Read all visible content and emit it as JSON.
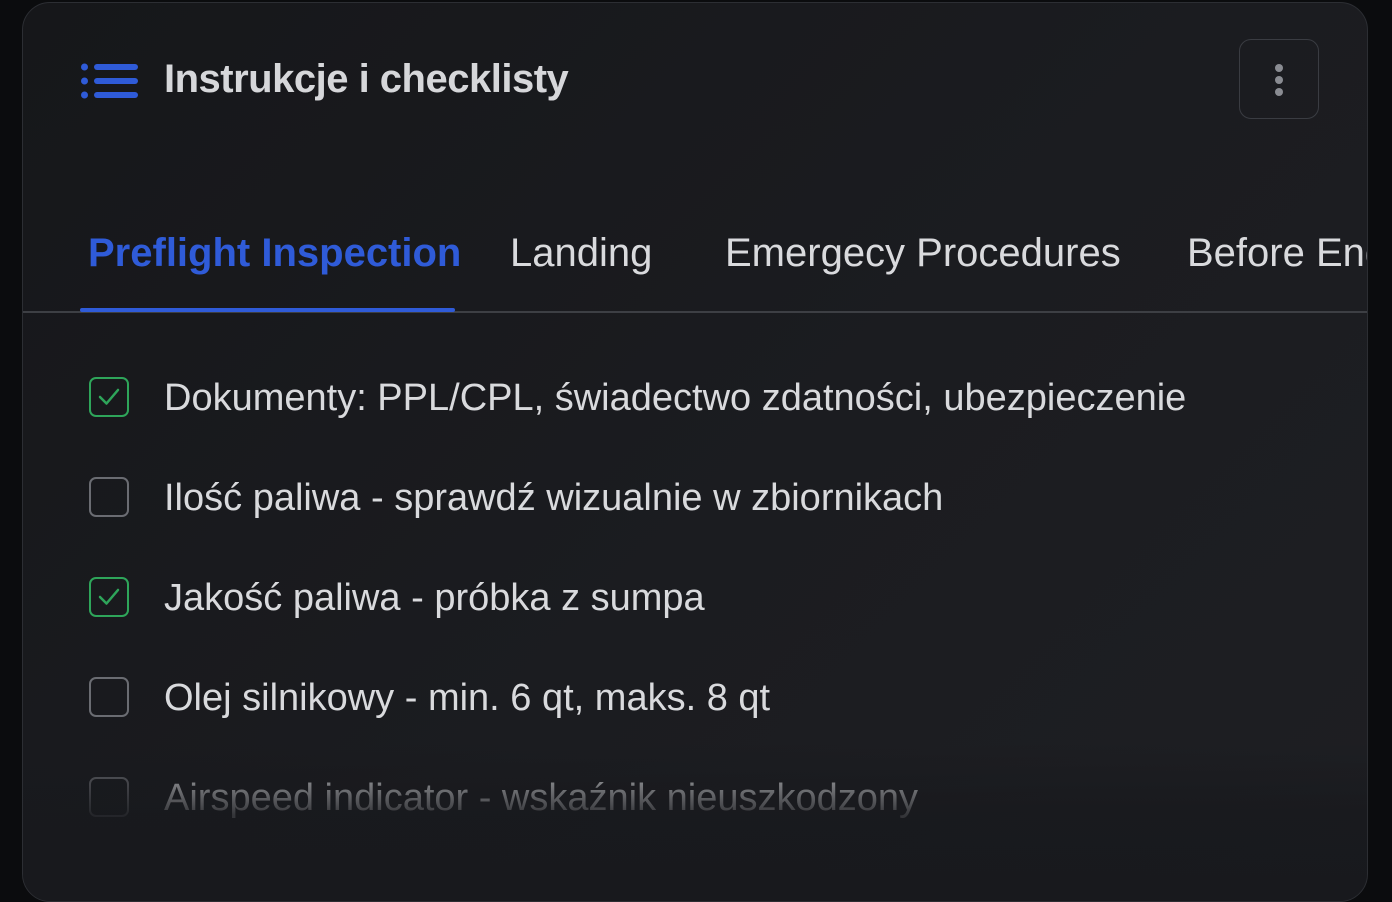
{
  "header": {
    "title": "Instrukcje i checklisty",
    "icon": "list-icon",
    "menu_icon": "more-vertical-icon"
  },
  "tabs": [
    {
      "label": "Preflight Inspection",
      "active": true
    },
    {
      "label": "Landing",
      "active": false
    },
    {
      "label": "Emergecy Procedures",
      "active": false
    },
    {
      "label": "Before Eng",
      "active": false
    }
  ],
  "checklist": [
    {
      "label": "Dokumenty: PPL/CPL, świadectwo zdatności, ubezpieczenie",
      "checked": true
    },
    {
      "label": "Ilość paliwa - sprawdź wizualnie w zbiornikach",
      "checked": false
    },
    {
      "label": "Jakość paliwa - próbka z sumpa",
      "checked": true
    },
    {
      "label": "Olej silnikowy - min. 6 qt, maks. 8 qt",
      "checked": false
    },
    {
      "label": "Airspeed indicator - wskaźnik nieuszkodzony",
      "checked": false
    }
  ],
  "colors": {
    "accent": "#2f5bd8",
    "check": "#2ea55a",
    "background": "#17181b",
    "text": "#d9dadd"
  }
}
